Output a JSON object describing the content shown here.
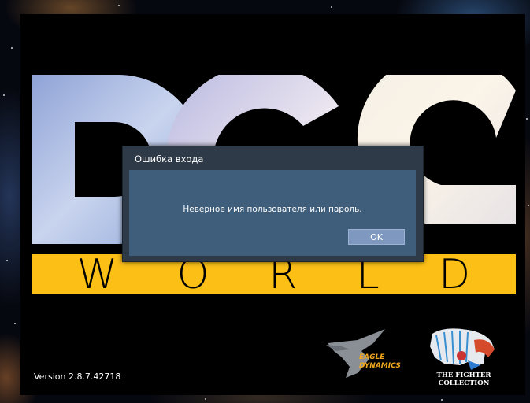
{
  "splash": {
    "world_letters": [
      "W",
      "O",
      "R",
      "L",
      "D"
    ],
    "version": "Version 2.8.7.42718",
    "eagle_logo_text": [
      "EAGLE",
      "DYNAMICS"
    ],
    "tfc_logo_text": "THE FIGHTER COLLECTION",
    "colors": {
      "world_bar": "#fbbf16",
      "background": "#000000"
    }
  },
  "dialog": {
    "title": "Ошибка входа",
    "message": "Неверное имя пользователя или пароль.",
    "ok_label": "OK",
    "colors": {
      "frame": "#2e3a47",
      "body": "#3e5e7b",
      "button": "#7e98c0"
    }
  },
  "icons": {
    "eagle": "eagle-dynamics-logo",
    "tfc": "the-fighter-collection-logo"
  }
}
